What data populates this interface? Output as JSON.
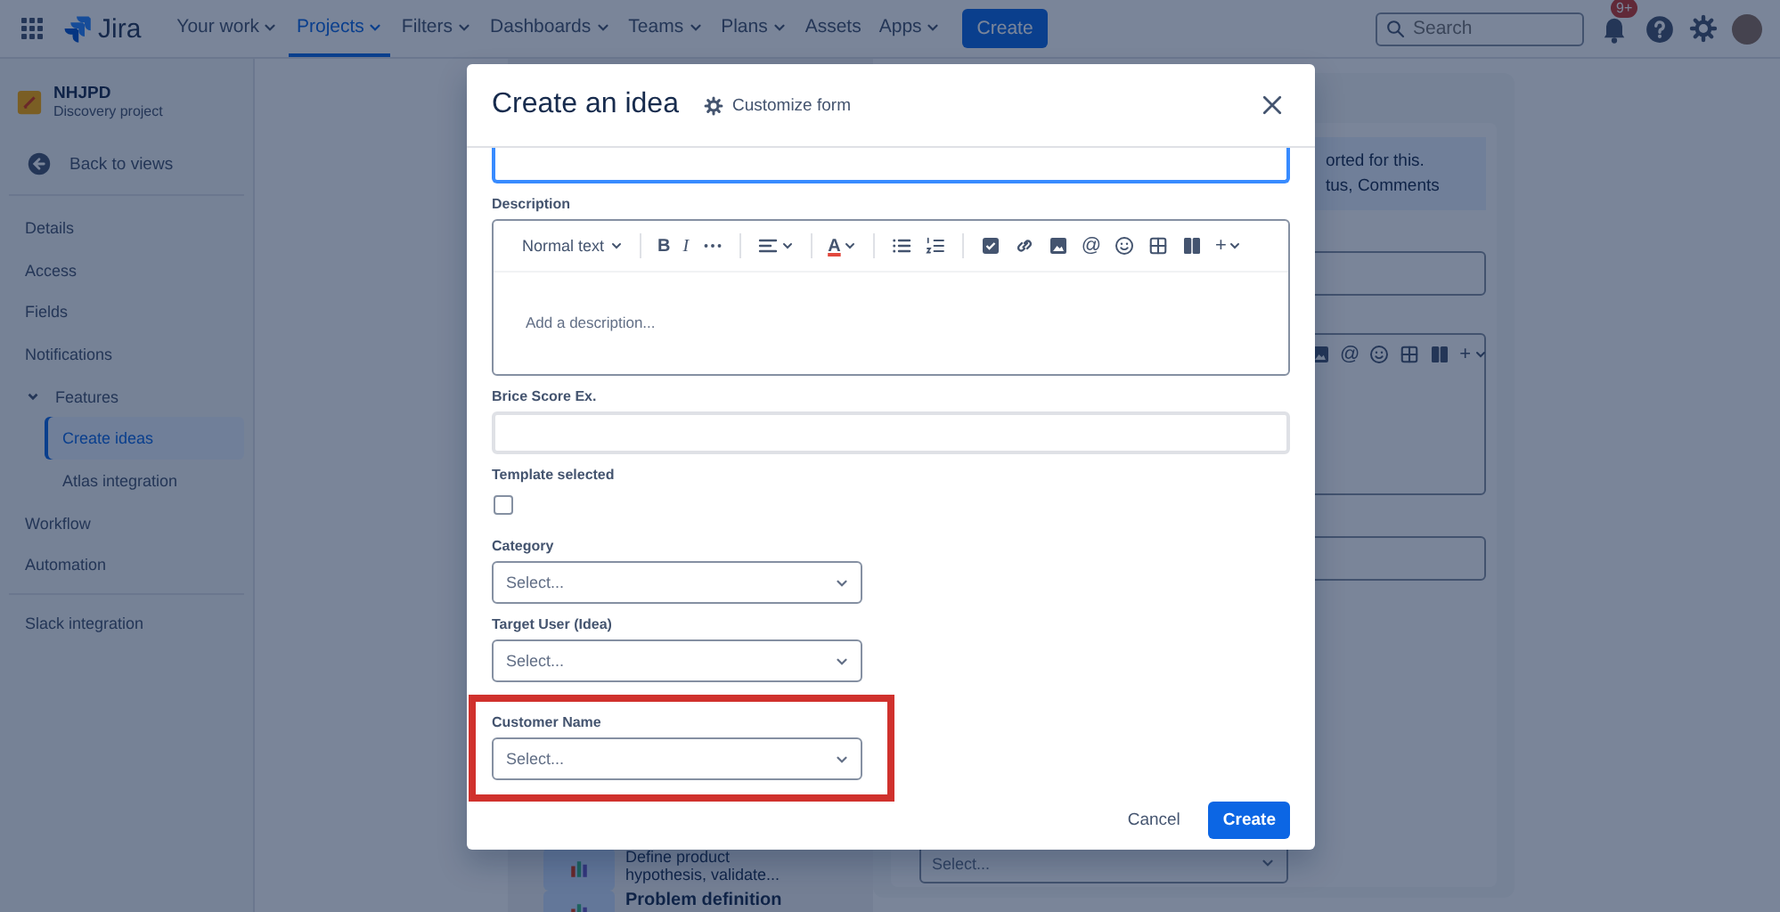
{
  "topbar": {
    "product": "Jira",
    "nav": [
      {
        "label": "Your work",
        "caret": true,
        "selected": false
      },
      {
        "label": "Projects",
        "caret": true,
        "selected": true
      },
      {
        "label": "Filters",
        "caret": true,
        "selected": false
      },
      {
        "label": "Dashboards",
        "caret": true,
        "selected": false
      },
      {
        "label": "Teams",
        "caret": true,
        "selected": false
      },
      {
        "label": "Plans",
        "caret": true,
        "selected": false
      },
      {
        "label": "Assets",
        "caret": false,
        "selected": false
      },
      {
        "label": "Apps",
        "caret": true,
        "selected": false
      }
    ],
    "create_button": "Create",
    "search": {
      "placeholder": "Search"
    },
    "notifications_badge": "9+"
  },
  "sidebar": {
    "project_name": "NHJPD",
    "project_type": "Discovery project",
    "back_link": "Back to views",
    "sections": [
      [
        {
          "label": "Details",
          "selected": false
        },
        {
          "label": "Access",
          "selected": false
        },
        {
          "label": "Fields",
          "selected": false
        },
        {
          "label": "Notifications",
          "selected": false
        },
        {
          "label": "Features",
          "selected": false,
          "expanded": true,
          "children": [
            {
              "label": "Create ideas",
              "selected": true
            },
            {
              "label": "Atlas integration",
              "selected": false
            }
          ]
        },
        {
          "label": "Workflow",
          "selected": false
        },
        {
          "label": "Automation",
          "selected": false
        }
      ],
      [
        {
          "label": "Slack integration",
          "selected": false
        }
      ]
    ]
  },
  "background_cards": [
    {
      "lines": [
        "Define product",
        "hypothesis, validate..."
      ]
    },
    {
      "lines": [
        "Problem definition"
      ]
    }
  ],
  "background_panel": {
    "info_lines": [
      "orted for this.",
      "tus, Comments"
    ],
    "toolbar": [
      {
        "kind": "image"
      },
      {
        "kind": "mention",
        "label": "@"
      },
      {
        "kind": "emoji"
      },
      {
        "kind": "table"
      },
      {
        "kind": "layout"
      },
      {
        "kind": "insert",
        "label": "+",
        "caret": true
      }
    ],
    "select_placeholder": "Select..."
  },
  "modal": {
    "title": "Create an idea",
    "customize_link": "Customize form",
    "fields": [
      {
        "kind": "text",
        "focused": true
      },
      {
        "kind": "editor",
        "label": "Description",
        "placeholder": "Add a description...",
        "toolbar": [
          [
            {
              "kind": "text-style",
              "label": "Normal text",
              "caret": true
            }
          ],
          [
            {
              "kind": "bold",
              "label": "B"
            },
            {
              "kind": "italic",
              "label": "I"
            },
            {
              "kind": "more"
            }
          ],
          [
            {
              "kind": "align",
              "caret": true
            }
          ],
          [
            {
              "kind": "text-color",
              "label": "A",
              "caret": true
            }
          ],
          [
            {
              "kind": "bullet-list"
            },
            {
              "kind": "numbered-list"
            }
          ],
          [
            {
              "kind": "task"
            },
            {
              "kind": "link"
            },
            {
              "kind": "image"
            },
            {
              "kind": "mention",
              "label": "@"
            },
            {
              "kind": "emoji"
            },
            {
              "kind": "table"
            },
            {
              "kind": "layout"
            },
            {
              "kind": "insert",
              "label": "+",
              "caret": true
            }
          ]
        ]
      },
      {
        "kind": "text",
        "label": "Brice Score Ex.",
        "focused": false
      },
      {
        "kind": "checkbox",
        "label": "Template selected",
        "checked": false
      },
      {
        "kind": "select",
        "label": "Category",
        "placeholder": "Select...",
        "highlighted": false
      },
      {
        "kind": "select",
        "label": "Target User (Idea)",
        "placeholder": "Select...",
        "highlighted": false
      },
      {
        "kind": "select",
        "label": "Customer Name",
        "placeholder": "Select...",
        "highlighted": true
      }
    ],
    "buttons": [
      {
        "kind": "subtle",
        "label": "Cancel"
      },
      {
        "kind": "primary",
        "label": "Create"
      }
    ]
  }
}
